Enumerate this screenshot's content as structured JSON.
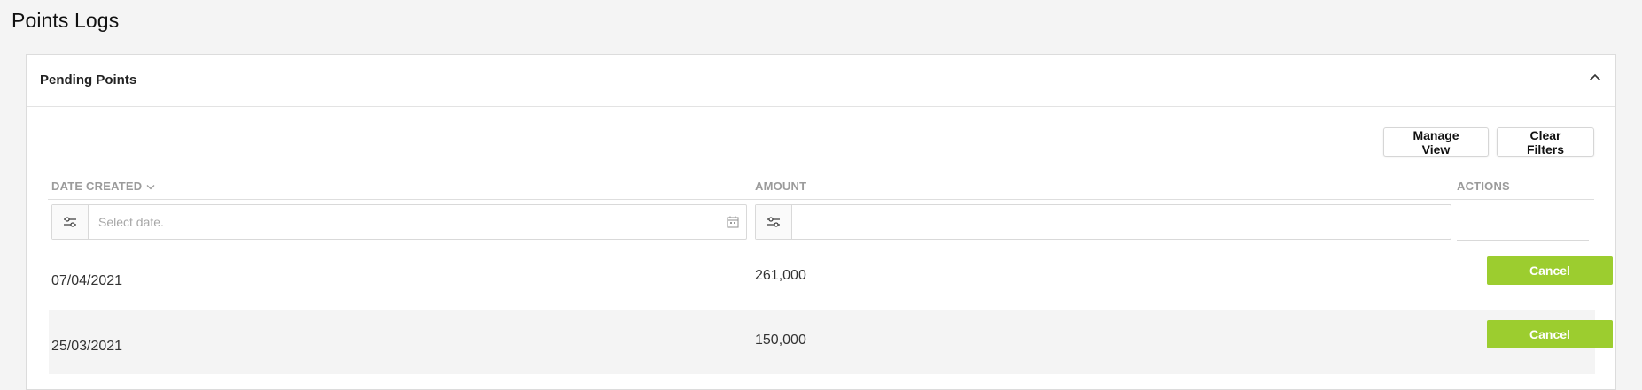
{
  "page": {
    "title": "Points Logs"
  },
  "panel": {
    "title": "Pending Points",
    "collapse_icon": "chevron-up-icon"
  },
  "toolbar": {
    "manage_view_label": "Manage View",
    "clear_filters_label": "Clear Filters"
  },
  "table": {
    "columns": [
      {
        "label": "DATE CREATED",
        "sort_icon": "chevron-down-icon"
      },
      {
        "label": "AMOUNT"
      },
      {
        "label": "ACTIONS"
      }
    ],
    "filters": {
      "date_placeholder": "Select date.",
      "date_value": "",
      "amount_value": "",
      "filter_icon": "sliders-icon",
      "calendar_icon": "calendar-icon"
    },
    "rows": [
      {
        "date": "07/04/2021",
        "amount": "261,000",
        "action_label": "Cancel"
      },
      {
        "date": "25/03/2021",
        "amount": "150,000",
        "action_label": "Cancel"
      }
    ]
  },
  "colors": {
    "accent_green": "#9ccd2f",
    "header_gray": "#9b9b9b",
    "page_bg": "#f4f4f4"
  }
}
